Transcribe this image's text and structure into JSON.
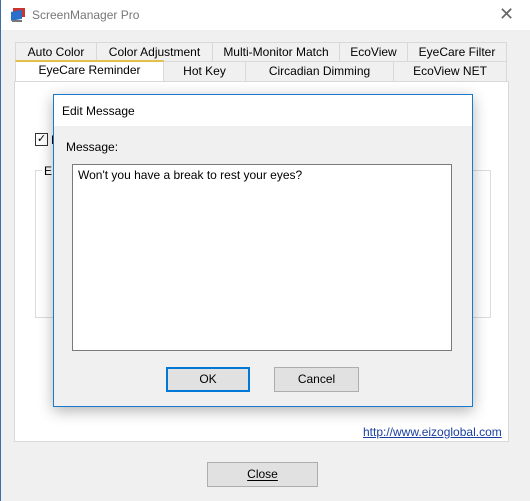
{
  "window": {
    "title": "ScreenManager Pro",
    "close_icon": "close-icon"
  },
  "tabs": {
    "row1": [
      {
        "label": "Auto Color"
      },
      {
        "label": "Color Adjustment"
      },
      {
        "label": "Multi-Monitor Match"
      },
      {
        "label": "EcoView"
      },
      {
        "label": "EyeCare Filter"
      }
    ],
    "row2": [
      {
        "label": "EyeCare Reminder",
        "selected": true
      },
      {
        "label": "Hot Key"
      },
      {
        "label": "Circadian Dimming"
      },
      {
        "label": "EcoView NET"
      }
    ]
  },
  "panel": {
    "checkbox_checked": true,
    "checkbox_label": "E",
    "group_label": "E",
    "link": "http://www.eizoglobal.com"
  },
  "footer": {
    "close_label": "Close"
  },
  "dialog": {
    "title": "Edit Message",
    "message_label": "Message:",
    "message_value": "Won't you have a break to rest your eyes?",
    "ok_label": "OK",
    "cancel_label": "Cancel",
    "accent": "#1979ca"
  }
}
